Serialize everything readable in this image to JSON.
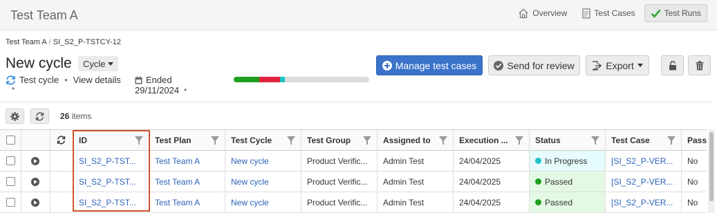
{
  "app": {
    "title": "Test Team A"
  },
  "topnav": [
    {
      "label": "Overview",
      "icon": "home-icon",
      "active": false
    },
    {
      "label": "Test Cases",
      "icon": "document-icon",
      "active": false
    },
    {
      "label": "Test Runs",
      "icon": "checkmark-icon",
      "active": true
    }
  ],
  "breadcrumb": {
    "root": "Test Team A",
    "separator": "/",
    "current": "SI_S2_P-TSTCY-12"
  },
  "header": {
    "title": "New cycle",
    "type_dropdown": "Cycle",
    "meta_type": "Test cycle",
    "meta_dot": "•",
    "view_details": "View details",
    "ended_label": "Ended",
    "ended_date": "29/11/2024"
  },
  "progress": [
    {
      "name": "passed",
      "fraction": 0.19,
      "color": "#1ea01e"
    },
    {
      "name": "failed",
      "fraction": 0.15,
      "color": "#e0243c"
    },
    {
      "name": "in-progress",
      "fraction": 0.04,
      "color": "#1cc4c4"
    },
    {
      "name": "not-run",
      "fraction": 0.62,
      "color": "#dcdcdc"
    }
  ],
  "actions": {
    "manage": "Manage test cases",
    "review": "Send for review",
    "export": "Export"
  },
  "toolbar": {
    "items_count": "26",
    "items_label": "items"
  },
  "table": {
    "columns": [
      "ID",
      "Test Plan",
      "Test Cycle",
      "Test Group",
      "Assigned to",
      "Execution ...",
      "Status",
      "Test Case",
      "Pass"
    ],
    "rows": [
      {
        "id": "SI_S2_P-TST...",
        "plan": "Test Team A",
        "cycle": "New cycle",
        "group": "Product Verific...",
        "assigned": "Admin Test",
        "execution": "24/04/2025",
        "status": "In Progress",
        "status_color": "#1cc4c4",
        "test_case": "[SI_S2_P-VER...",
        "pass": "No"
      },
      {
        "id": "SI_S2_P-TST...",
        "plan": "Test Team A",
        "cycle": "New cycle",
        "group": "Product Verific...",
        "assigned": "Admin Test",
        "execution": "24/04/2025",
        "status": "Passed",
        "status_color": "#1ea01e",
        "test_case": "[SI_S2_P-VER...",
        "pass": "No"
      },
      {
        "id": "SI_S2_P-TST...",
        "plan": "Test Team A",
        "cycle": "New cycle",
        "group": "Product Verific...",
        "assigned": "Admin Test",
        "execution": "24/04/2025",
        "status": "Passed",
        "status_color": "#1ea01e",
        "test_case": "[SI_S2_P-VER...",
        "pass": "No"
      }
    ]
  },
  "colors": {
    "primary": "#3a73c9",
    "highlight": "#d0502a",
    "link": "#2a62b9"
  }
}
